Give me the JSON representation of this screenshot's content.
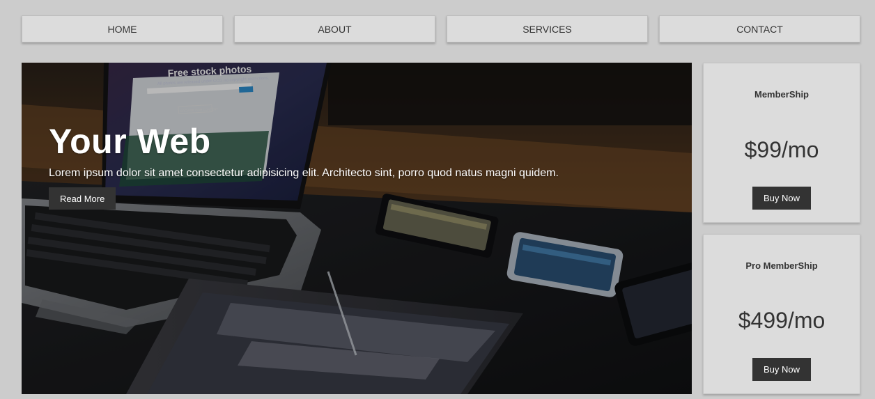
{
  "nav": {
    "items": [
      {
        "label": "HOME"
      },
      {
        "label": "ABOUT"
      },
      {
        "label": "SERVICES"
      },
      {
        "label": "CONTACT"
      }
    ]
  },
  "hero": {
    "title": "Your Web",
    "text": "Lorem ipsum dolor sit amet consectetur adipisicing elit. Architecto sint, porro quod natus magni quidem.",
    "button_label": "Read More",
    "image_screen_title": "Free stock photos",
    "image_screen_subtitle": "All photos are released under CC0, no copyright restrictions.",
    "image_screen_button": "BROWSE OUR CONTENT"
  },
  "pricing": [
    {
      "title": "MemberShip",
      "price": "$99/mo",
      "button_label": "Buy Now"
    },
    {
      "title": "Pro MemberShip",
      "price": "$499/mo",
      "button_label": "Buy Now"
    }
  ],
  "colors": {
    "background": "#cccccc",
    "nav_bg": "#dcdcdc",
    "button_dark": "#333333",
    "text": "#333333"
  }
}
